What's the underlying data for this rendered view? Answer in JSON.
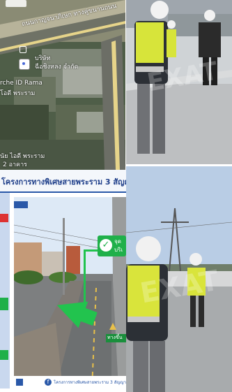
{
  "map": {
    "road_label": "ถนนกาญจนาภิเษก ทางคู่ขนานถนน",
    "company_line1": "บริษัท",
    "company_line2": "ฉือชิงหลง จำกัด",
    "place_left_1": "rche ID Rama",
    "place_left_2": "โอดี พระราม",
    "place_bottom_1": "นัย ไอดี พระราม",
    "place_bottom_2": "2 อาคาร",
    "pin_icon": "location-pin-icon"
  },
  "banner": {
    "title": "โครงการทางพิเศษสายพระราม 3 สัญญา 2"
  },
  "street_panel": {
    "callout_text_1": "จุด",
    "callout_text_2": "บริเ",
    "footer_text": "โครงการทางพิเศษสายพระราม 3 สัญญา 2",
    "sign_label": "ทางขึ้น",
    "colors": {
      "callout": "#1fb04a",
      "arrow": "#22c34e",
      "footer": "#ffffff"
    }
  },
  "photos": {
    "watermark": "EXAT",
    "top_right_alt": "",
    "bottom_right_alt": ""
  }
}
